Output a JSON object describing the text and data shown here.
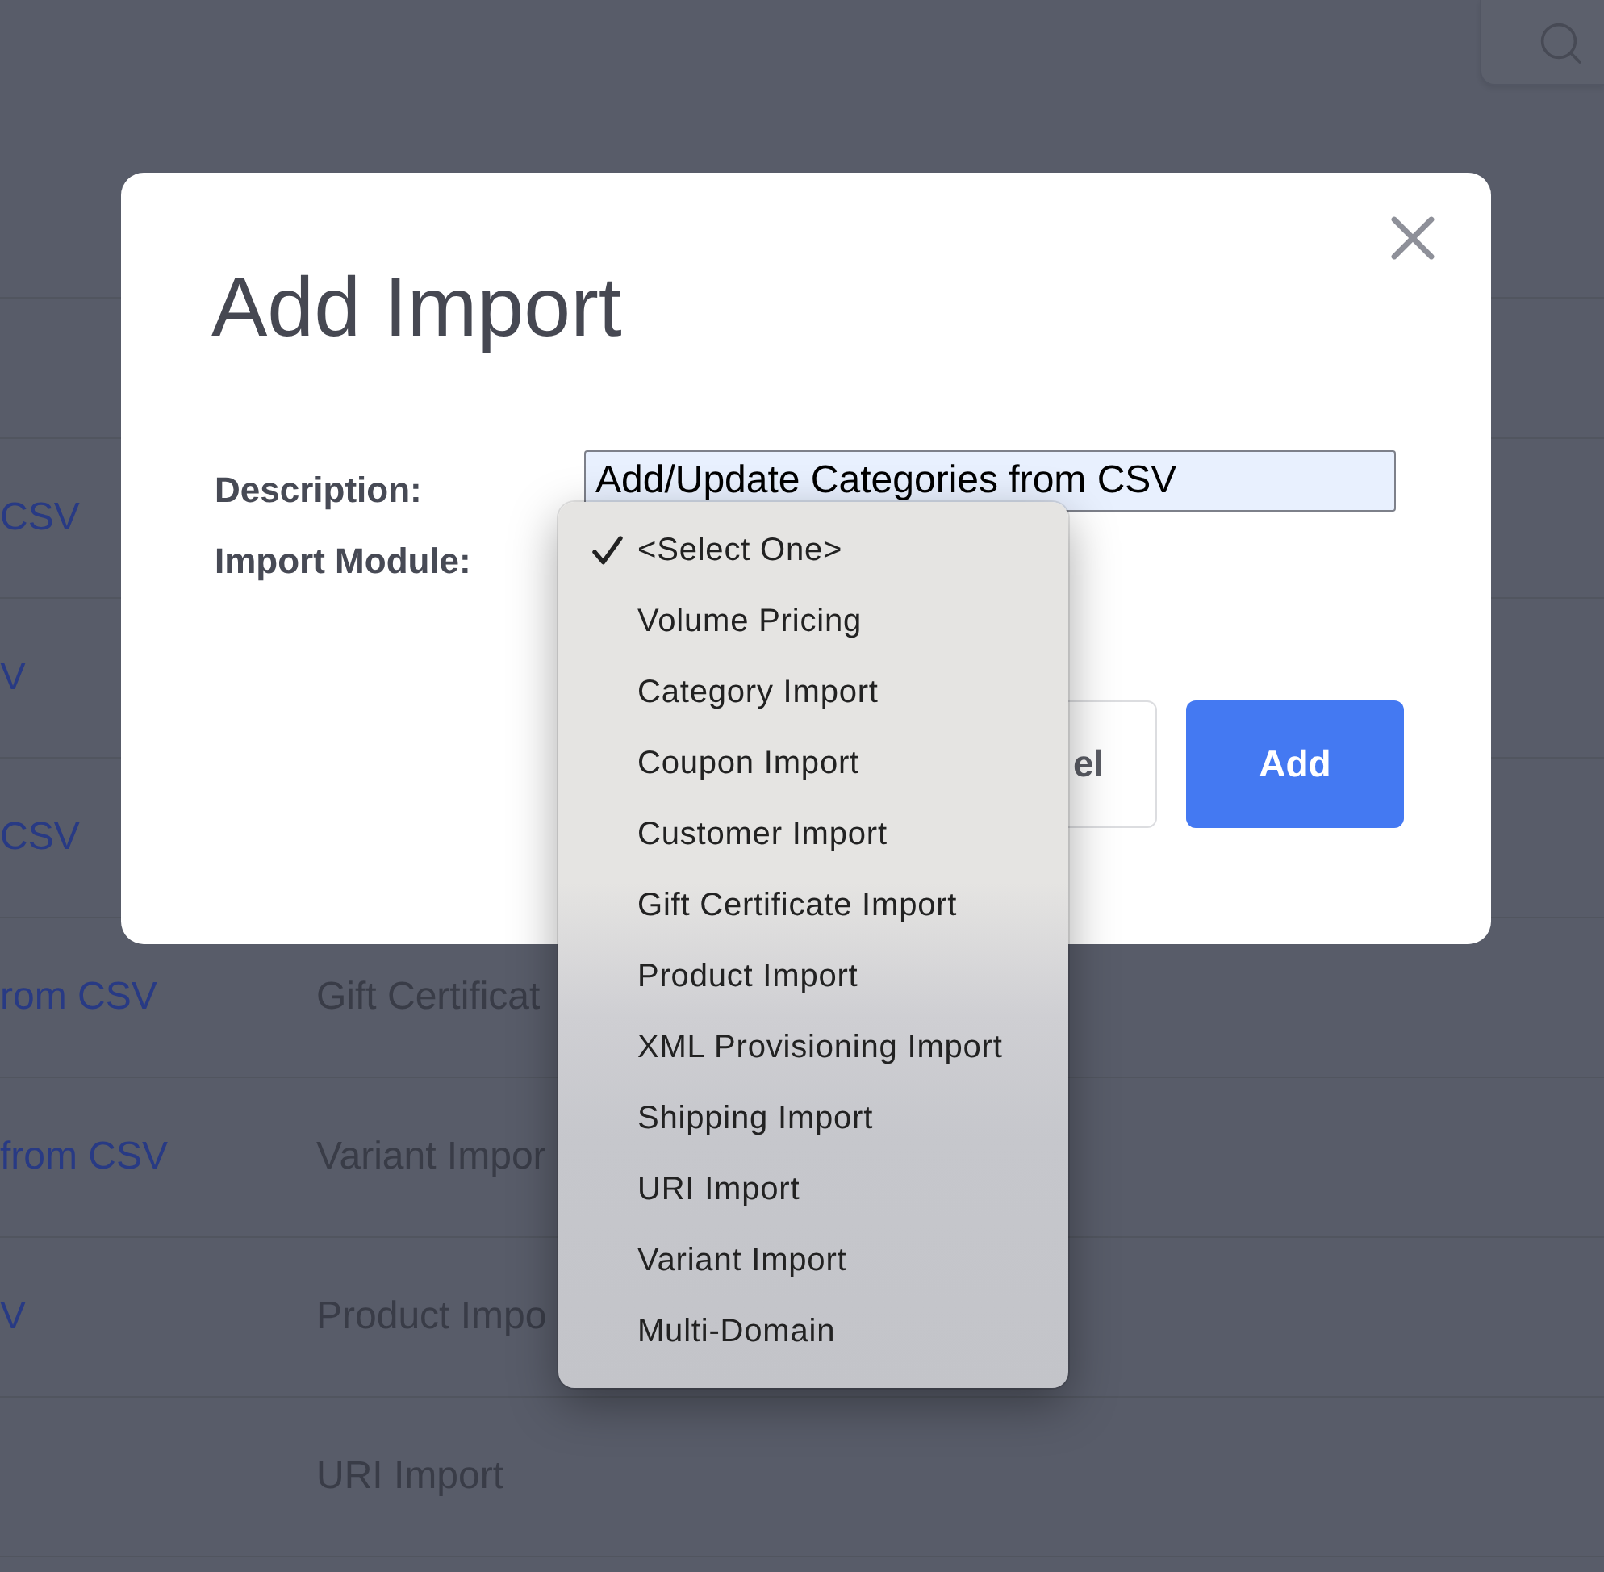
{
  "table": {
    "rows": [
      {
        "column_1": "CSV"
      },
      {
        "column_1": "V"
      },
      {
        "column_1": "CSV"
      },
      {
        "column_1": "rom CSV",
        "column_2": "Gift Certificat"
      },
      {
        "column_1": "from CSV",
        "column_2": "Variant Impor"
      },
      {
        "column_1": "V",
        "column_2": "Product Impo"
      },
      {
        "column_2": "URI Import"
      }
    ]
  },
  "dialog": {
    "title": "Add Import",
    "fields": [
      {
        "kind": "text",
        "label": "Description:",
        "value": "Add/Update Categories from CSV"
      },
      {
        "kind": "select",
        "label": "Import Module:",
        "options": [
          {
            "label": "<Select One>",
            "selected": true
          },
          {
            "label": "Volume Pricing",
            "selected": false
          },
          {
            "label": "Category Import",
            "selected": false
          },
          {
            "label": "Coupon Import",
            "selected": false
          },
          {
            "label": "Customer Import",
            "selected": false
          },
          {
            "label": "Gift Certificate Import",
            "selected": false
          },
          {
            "label": "Product Import",
            "selected": false
          },
          {
            "label": "XML Provisioning Import",
            "selected": false
          },
          {
            "label": "Shipping Import",
            "selected": false
          },
          {
            "label": "URI Import",
            "selected": false
          },
          {
            "label": "Variant Import",
            "selected": false
          },
          {
            "label": "Multi-Domain",
            "selected": false
          }
        ]
      }
    ],
    "buttons": [
      {
        "kind": "secondary",
        "label": "el"
      },
      {
        "kind": "primary",
        "label": "Add"
      }
    ]
  }
}
